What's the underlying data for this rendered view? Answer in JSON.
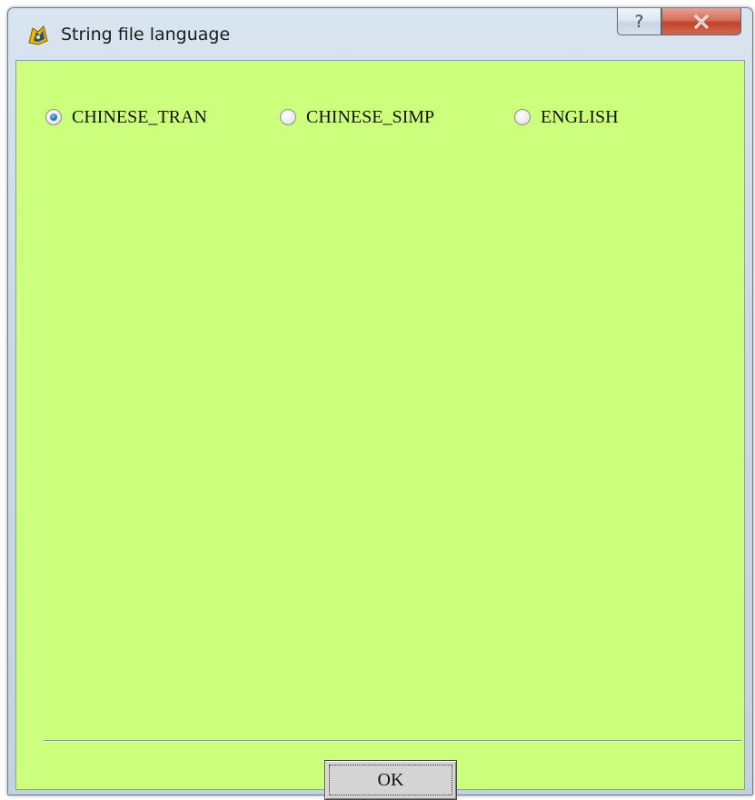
{
  "window": {
    "title": "String file language",
    "help_glyph": "?",
    "close_glyph": "✕",
    "icons": {
      "app": "app-logo-icon",
      "help": "help-icon",
      "close": "close-icon"
    }
  },
  "language_options": [
    {
      "label": "CHINESE_TRAN",
      "checked": true
    },
    {
      "label": "CHINESE_SIMP",
      "checked": false
    },
    {
      "label": "ENGLISH",
      "checked": false
    }
  ],
  "buttons": {
    "ok_label": "OK"
  },
  "colors": {
    "client_background": "#ccff7c",
    "close_button": "#c0432b",
    "radio_selected": "#2a6fb8"
  }
}
